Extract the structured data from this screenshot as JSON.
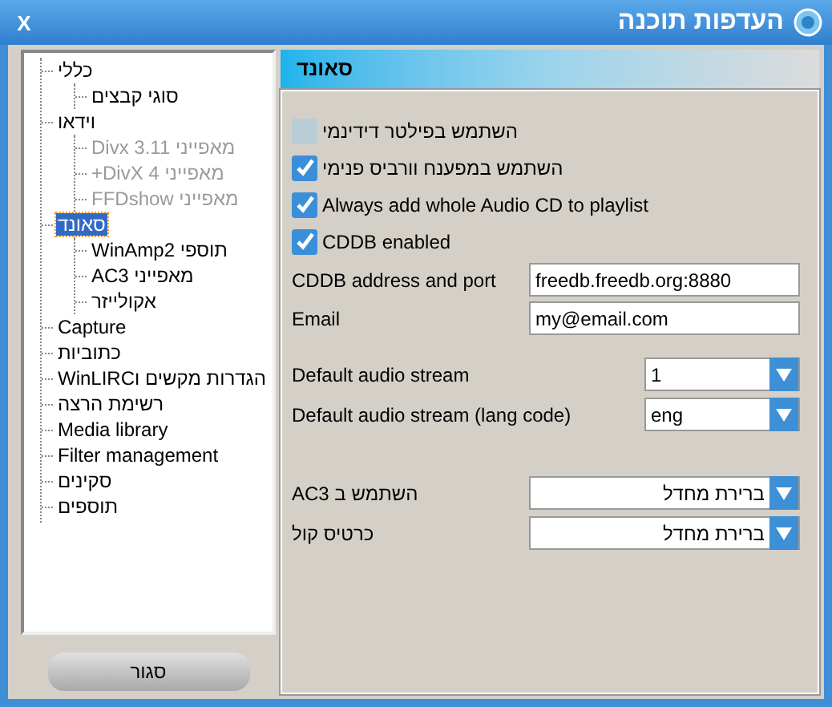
{
  "window": {
    "title": "העדפות תוכנה",
    "close": "X"
  },
  "tree": [
    {
      "label": "כללי",
      "selected": false,
      "disabled": false,
      "children": [
        {
          "label": "סוגי קבצים",
          "selected": false,
          "disabled": false
        }
      ]
    },
    {
      "label": "וידאו",
      "selected": false,
      "disabled": false,
      "children": [
        {
          "label": "מאפייני Divx 3.11",
          "selected": false,
          "disabled": true
        },
        {
          "label": "מאפייני DivX 4+",
          "selected": false,
          "disabled": true
        },
        {
          "label": "מאפייני FFDshow",
          "selected": false,
          "disabled": true
        }
      ]
    },
    {
      "label": "סאונד",
      "selected": true,
      "disabled": false,
      "children": [
        {
          "label": "תוספי WinAmp2",
          "selected": false,
          "disabled": false
        },
        {
          "label": "מאפייני AC3",
          "selected": false,
          "disabled": false
        },
        {
          "label": "אקולייזר",
          "selected": false,
          "disabled": false
        }
      ]
    },
    {
      "label": "Capture",
      "selected": false,
      "disabled": false
    },
    {
      "label": "כתוביות",
      "selected": false,
      "disabled": false
    },
    {
      "label": "הגדרות מקשים וWinLIRC",
      "selected": false,
      "disabled": false
    },
    {
      "label": "רשימת הרצה",
      "selected": false,
      "disabled": false
    },
    {
      "label": "Media library",
      "selected": false,
      "disabled": false
    },
    {
      "label": "Filter management",
      "selected": false,
      "disabled": false
    },
    {
      "label": "סקינים",
      "selected": false,
      "disabled": false
    },
    {
      "label": "תוספים",
      "selected": false,
      "disabled": false
    }
  ],
  "close_button": "סגור",
  "panel": {
    "title": "סאונד",
    "checkboxes": [
      {
        "label": "השתמש בפילטר דידינמי",
        "checked": false
      },
      {
        "label": "השתמש במפענח וורביס פנימי",
        "checked": true
      },
      {
        "label": "Always add whole Audio CD to playlist",
        "checked": true
      },
      {
        "label": "CDDB enabled",
        "checked": true
      }
    ],
    "fields": [
      {
        "label": "CDDB address and port",
        "value": "freedb.freedb.org:8880"
      },
      {
        "label": "Email",
        "value": "my@email.com"
      }
    ],
    "streams": [
      {
        "label": "Default audio stream",
        "value": "1"
      },
      {
        "label": "Default audio stream (lang code)",
        "value": "eng"
      }
    ],
    "outputs": [
      {
        "label": "השתמש ב AC3",
        "value": "ברירת מחדל"
      },
      {
        "label": "כרטיס קול",
        "value": "ברירת מחדל"
      }
    ]
  }
}
